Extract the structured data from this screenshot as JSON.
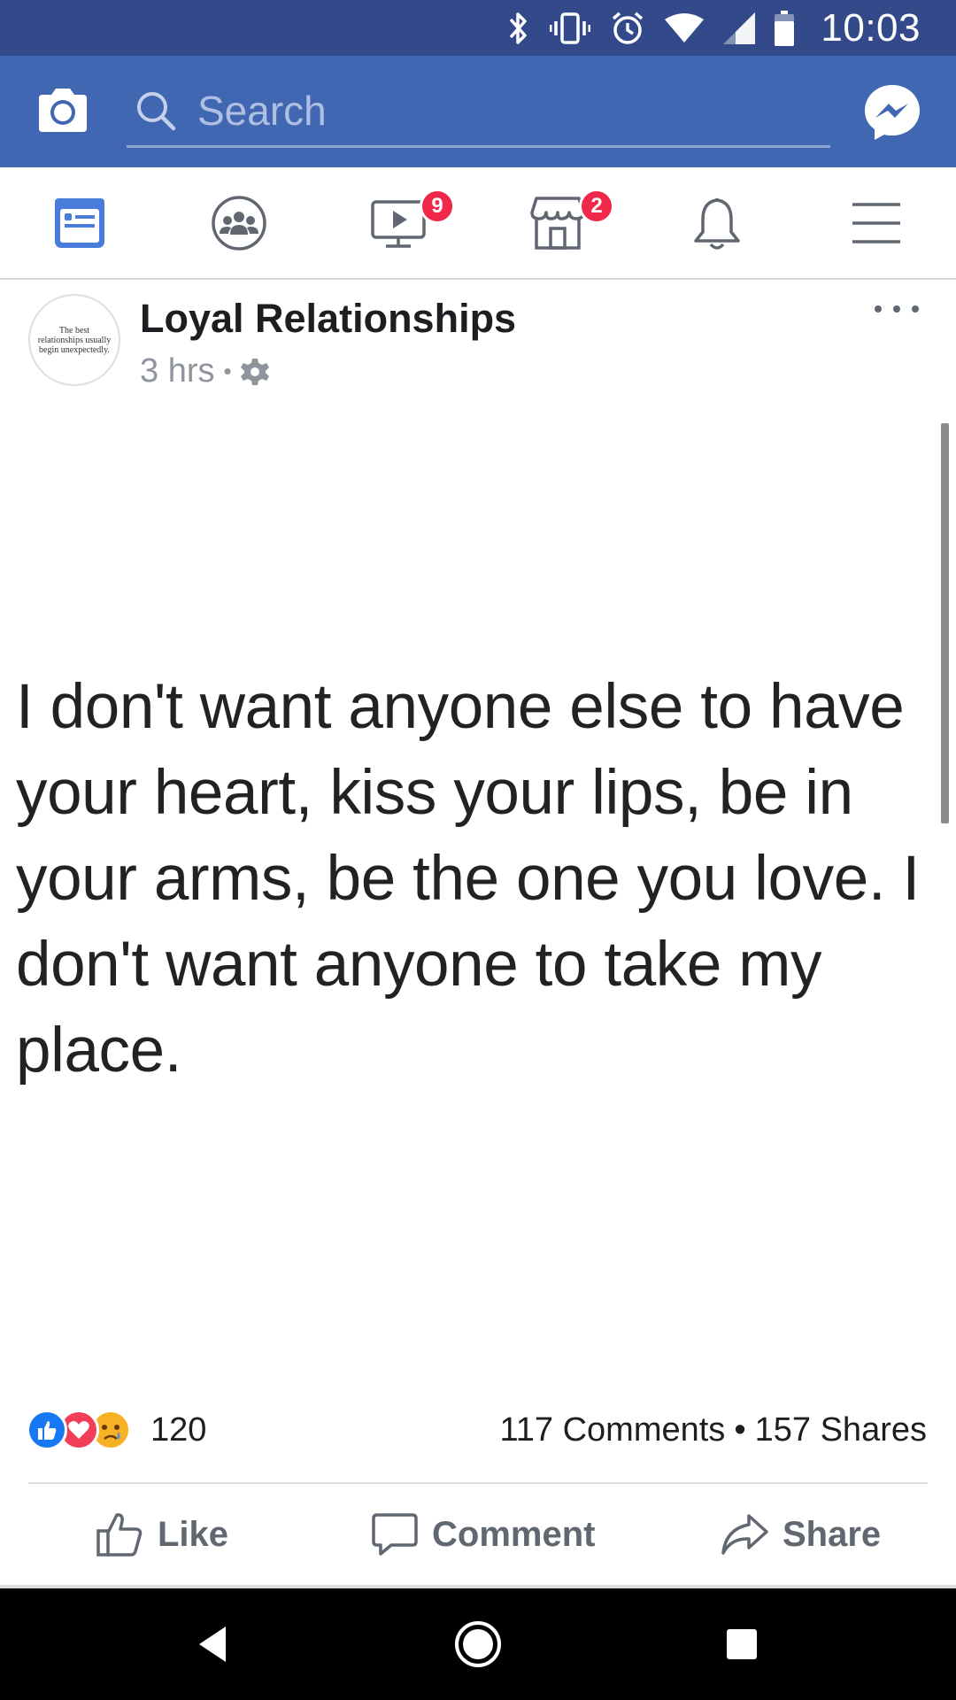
{
  "status_bar": {
    "time": "10:03",
    "icons": [
      "bluetooth-icon",
      "vibrate-icon",
      "alarm-icon",
      "wifi-icon",
      "signal-icon",
      "battery-icon"
    ]
  },
  "header": {
    "camera_icon": "camera-icon",
    "search_placeholder": "Search",
    "messenger_icon": "messenger-icon",
    "brand_color": "#4267b2"
  },
  "nav": {
    "items": [
      {
        "name": "news-feed",
        "icon": "news-feed-icon",
        "active": true,
        "badge": ""
      },
      {
        "name": "groups",
        "icon": "groups-icon",
        "active": false,
        "badge": ""
      },
      {
        "name": "watch",
        "icon": "watch-icon",
        "active": false,
        "badge": "9"
      },
      {
        "name": "marketplace",
        "icon": "marketplace-icon",
        "active": false,
        "badge": "2"
      },
      {
        "name": "notifications",
        "icon": "bell-icon",
        "active": false,
        "badge": ""
      },
      {
        "name": "menu",
        "icon": "hamburger-menu-icon",
        "active": false,
        "badge": ""
      }
    ],
    "active_color": "#4a7cdb",
    "badge_color": "#f02849"
  },
  "post": {
    "avatar_text": "The best relationships usually begin unexpectedly.",
    "page_name": "Loyal Relationships",
    "time": "3 hrs",
    "privacy_icon": "gear-icon",
    "quote": "I don't want anyone else to have your heart, kiss your lips, be in your arms, be the one you love. I don't want anyone to take my place.",
    "reactions": [
      "like",
      "love",
      "sad"
    ],
    "reaction_count": "120",
    "comments": "117 Comments",
    "shares": "157 Shares",
    "actions": {
      "like": "Like",
      "comment": "Comment",
      "share": "Share"
    }
  }
}
